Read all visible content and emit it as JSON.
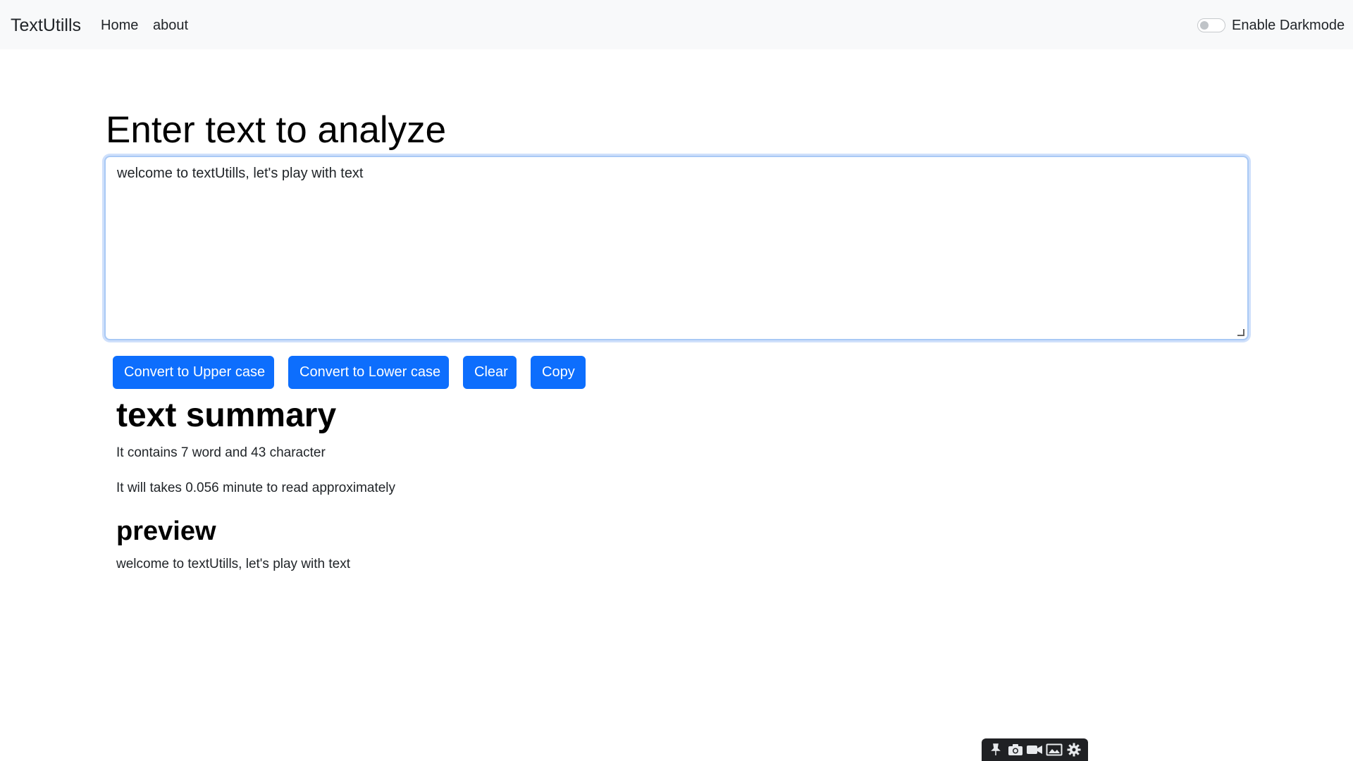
{
  "navbar": {
    "brand": "TextUtills",
    "links": [
      "Home",
      "about"
    ],
    "darkmode_label": "Enable Darkmode",
    "darkmode_enabled": false
  },
  "main": {
    "heading": "Enter text to analyze",
    "textarea_value": "welcome to textUtills, let's play with text",
    "buttons": {
      "upper": "Convert to Upper case",
      "lower": "Convert to Lower case",
      "clear": "Clear",
      "copy": "Copy"
    },
    "summary_title": "text summary",
    "summary_words": "It contains 7 word and 43 character",
    "summary_time": "It will takes 0.056 minute to read approximately",
    "preview_title": "preview",
    "preview_text": "welcome to textUtills, let's play with text"
  },
  "capture_toolbar": {
    "icons": [
      "pin-icon",
      "camera-icon",
      "video-icon",
      "image-icon",
      "gear-icon"
    ]
  },
  "colors": {
    "primary": "#0d6efd",
    "navbar_bg": "#f8f9fa",
    "focus_ring": "#a9c9f5"
  }
}
